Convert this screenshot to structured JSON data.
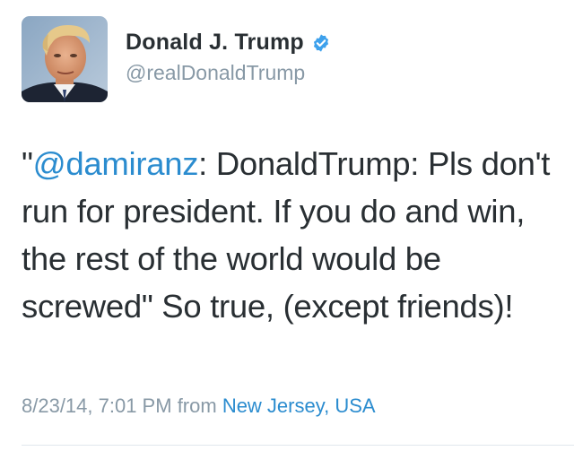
{
  "author": {
    "display_name": "Donald J. Trump",
    "handle": "@realDonaldTrump",
    "verified": true,
    "verified_icon": "verified-badge-icon"
  },
  "tweet": {
    "quote_open": "\"",
    "mention": "@damiranz",
    "text_after_mention": ": DonaldTrump: Pls don't run for president. If you do and win, the rest of the world would be screwed\" So true, (except friends)!"
  },
  "meta": {
    "timestamp": "8/23/14, 7:01 PM",
    "from_label": "from",
    "location": "New Jersey, USA"
  },
  "colors": {
    "link": "#2b8ccf",
    "secondary_text": "#8899a6",
    "primary_text": "#292f33",
    "verified_badge": "#3ea1ec"
  }
}
